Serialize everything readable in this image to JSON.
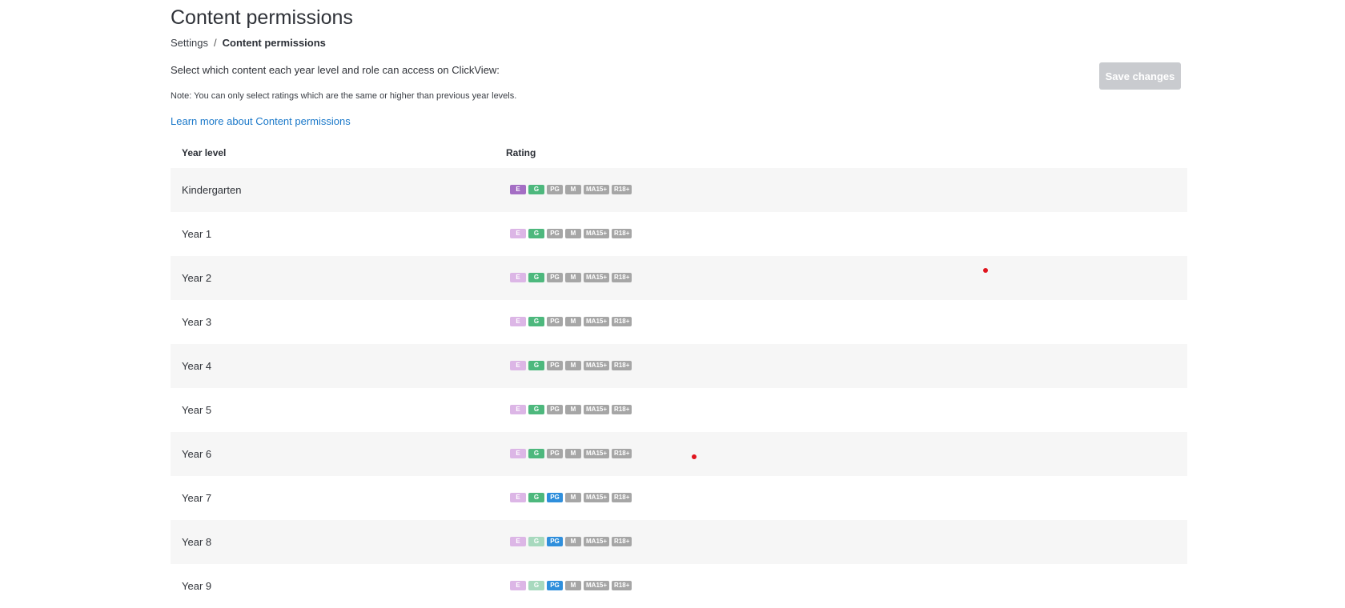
{
  "page": {
    "title": "Content permissions",
    "breadcrumb": {
      "parent": "Settings",
      "separator": "/",
      "current": "Content permissions"
    },
    "description": "Select which content each year level and role can access on ClickView:",
    "note": "Note: You can only select ratings which are the same or higher than previous year levels.",
    "learn_more": "Learn more about Content permissions",
    "save_label": "Save changes"
  },
  "table": {
    "headers": {
      "year": "Year level",
      "rating": "Rating"
    },
    "rating_labels": [
      "E",
      "G",
      "PG",
      "M",
      "MA15+",
      "R18+"
    ],
    "rows": [
      {
        "year": "Kindergarten",
        "enabled": [
          true,
          true,
          false,
          false,
          false,
          false
        ]
      },
      {
        "year": "Year 1",
        "enabled": [
          false,
          true,
          false,
          false,
          false,
          false
        ]
      },
      {
        "year": "Year 2",
        "enabled": [
          false,
          true,
          false,
          false,
          false,
          false
        ]
      },
      {
        "year": "Year 3",
        "enabled": [
          false,
          true,
          false,
          false,
          false,
          false
        ]
      },
      {
        "year": "Year 4",
        "enabled": [
          false,
          true,
          false,
          false,
          false,
          false
        ]
      },
      {
        "year": "Year 5",
        "enabled": [
          false,
          true,
          false,
          false,
          false,
          false
        ]
      },
      {
        "year": "Year 6",
        "enabled": [
          false,
          true,
          false,
          false,
          false,
          false
        ]
      },
      {
        "year": "Year 7",
        "enabled": [
          false,
          true,
          true,
          false,
          false,
          false
        ]
      },
      {
        "year": "Year 8",
        "enabled": [
          false,
          false,
          true,
          false,
          false,
          false
        ]
      },
      {
        "year": "Year 9",
        "enabled": [
          false,
          false,
          true,
          false,
          false,
          false
        ]
      }
    ]
  },
  "colors": {
    "E_on": "#a46ec4",
    "E_off": "#dcb6e6",
    "G_on": "#4db87d",
    "G_off": "#a7d9be",
    "PG_on": "#2f8fdc",
    "inactive": "#a6a6a6",
    "link": "#1a78c9",
    "save_disabled": "#c9cbcf",
    "marker": "#e0141e"
  }
}
